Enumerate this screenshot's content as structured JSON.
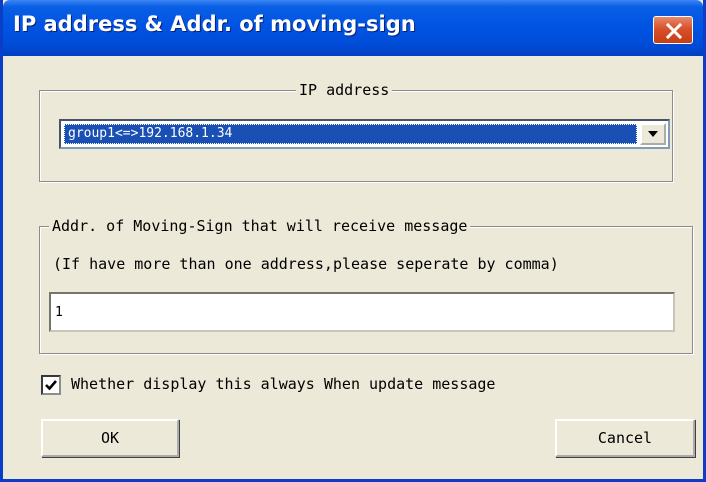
{
  "window": {
    "title": "IP address & Addr. of moving-sign",
    "close_icon": "close-icon",
    "accent": "#0054e3",
    "close_color": "#d9512c"
  },
  "ip_group": {
    "legend": "IP address",
    "combo_value": "group1<=>192.168.1.34",
    "dropdown_icon": "chevron-down-icon"
  },
  "addr_group": {
    "legend": "Addr. of Moving-Sign that will receive message",
    "hint": "(If have more than one address,please seperate by comma)",
    "input_value": "1"
  },
  "always_display": {
    "label": "Whether display this always When update message",
    "checked": true,
    "check_icon": "checkmark-icon"
  },
  "buttons": {
    "ok": "OK",
    "cancel": "Cancel"
  }
}
